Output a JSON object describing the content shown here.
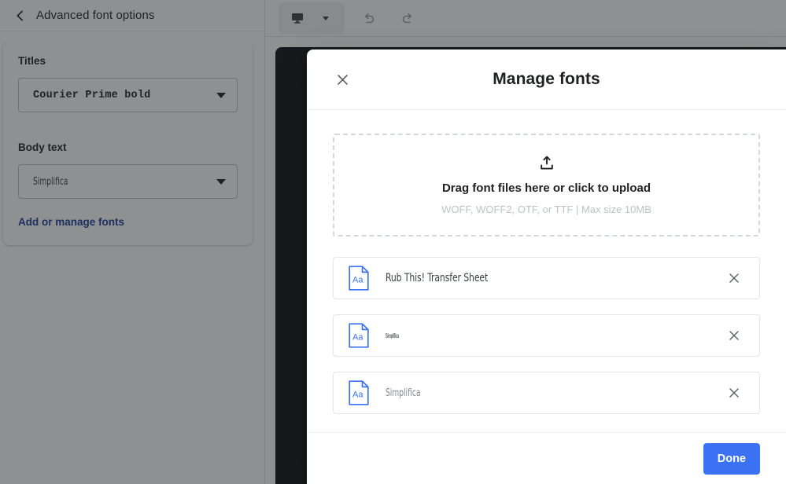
{
  "colors": {
    "accent_blue": "#3b71f3",
    "link_blue": "#1a3c9c",
    "icon_blue": "#3b71f3",
    "text_primary": "#202124",
    "text_muted": "#80868b",
    "placeholder_grey": "#bdc1c6",
    "scrim": "rgba(32,33,36,0.50)",
    "preview_dark": "#111114"
  },
  "sidebar": {
    "back_icon": "chevron-left-icon",
    "title": "Advanced font options",
    "fields": [
      {
        "label": "Titles",
        "value": "Courier Prime bold",
        "caret_icon": "caret-down-icon"
      },
      {
        "label": "Body text",
        "value": "Simplifica",
        "caret_icon": "caret-down-icon"
      }
    ],
    "manage_link": "Add or manage fonts"
  },
  "toolbar": {
    "buttons": [
      {
        "name": "desktop-preview",
        "icon": "monitor-icon"
      },
      {
        "name": "device-dropdown",
        "icon": "caret-down-icon"
      },
      {
        "name": "undo",
        "icon": "undo-icon"
      },
      {
        "name": "redo",
        "icon": "redo-icon"
      }
    ]
  },
  "modal": {
    "close_icon": "close-icon",
    "title": "Manage fonts",
    "dropzone": {
      "icon": "upload-icon",
      "primary_text": "Drag font files here or click to upload",
      "secondary_text": "WOFF, WOFF2, OTF, or TTF | Max size 10MB"
    },
    "fonts": [
      {
        "icon": "font-file-icon",
        "icon_label": "Aa",
        "name": "Rub This! Transfer Sheet",
        "remove_icon": "close-icon"
      },
      {
        "icon": "font-file-icon",
        "icon_label": "Aa",
        "name": "Simplifica",
        "remove_icon": "close-icon"
      },
      {
        "icon": "font-file-icon",
        "icon_label": "Aa",
        "name": "Simplifica",
        "remove_icon": "close-icon"
      }
    ],
    "footer": {
      "done_label": "Done"
    }
  }
}
